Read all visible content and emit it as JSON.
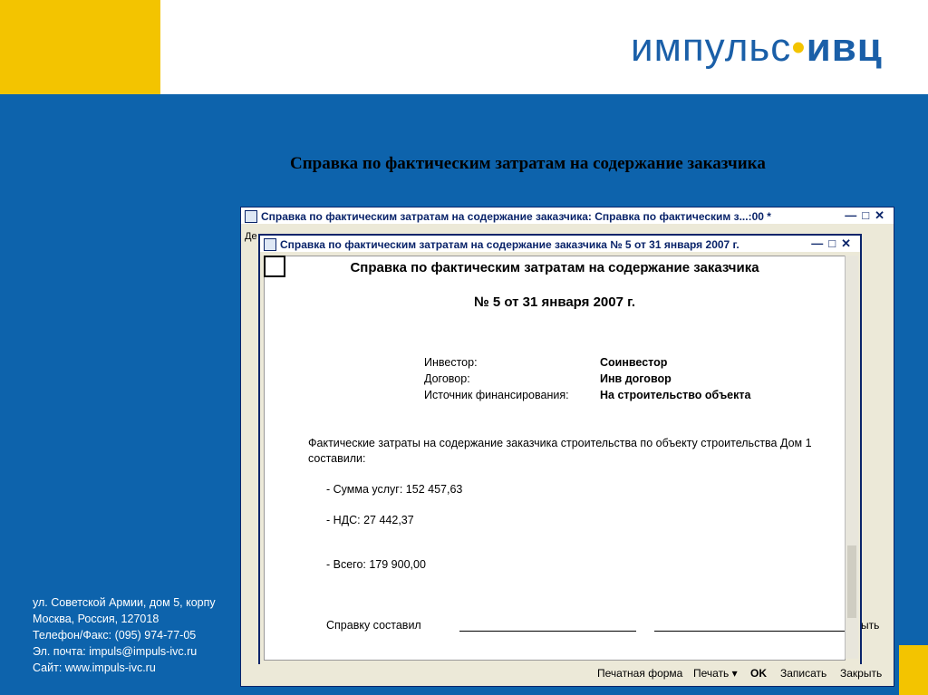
{
  "brand": {
    "left": "импульс",
    "dot": "•",
    "right": "ивц"
  },
  "slide_title": "Справка по фактическим затратам на содержание заказчика",
  "back_window": {
    "title": "Справка по фактическим затратам на содержание заказчика: Справка по фактическим з...:00 *",
    "menu_cut": "Де"
  },
  "front_window": {
    "title": "Справка по фактическим затратам на содержание заказчика  № 5 от 31 января 2007 г."
  },
  "document": {
    "title": "Справка по фактическим затратам на содержание заказчика",
    "number": "№ 5 от 31 января 2007 г.",
    "fields": [
      {
        "label": "Инвестор:",
        "value": "Соинвестор"
      },
      {
        "label": "Договор:",
        "value": "Инв договор"
      },
      {
        "label": "Источник финансирования:",
        "value": "На строительство объекта"
      }
    ],
    "paragraph": "Фактические затраты на содержание заказчика строительства по объекту строительства Дом 1 составили:",
    "sum": "- Сумма услуг: 152 457,63",
    "vat": "- НДС: 27 442,37",
    "total": "- Всего: 179 900,00",
    "signed": "Справку составил"
  },
  "buttons": {
    "print_form": "Печатная форма",
    "print": "Печать ▾",
    "ok": "OK",
    "save": "Записать",
    "close": "Закрыть",
    "close_partial": "ыть"
  },
  "address": [
    "ул. Советской Армии, дом 5, корпу",
    "Москва, Россия, 127018",
    "Телефон/Факс: (095) 974-77-05",
    "Эл. почта: impuls@impuls-ivc.ru",
    "Сайт: www.impuls-ivc.ru"
  ],
  "colors": {
    "background": "#0d63ac",
    "accent": "#f3c400"
  }
}
